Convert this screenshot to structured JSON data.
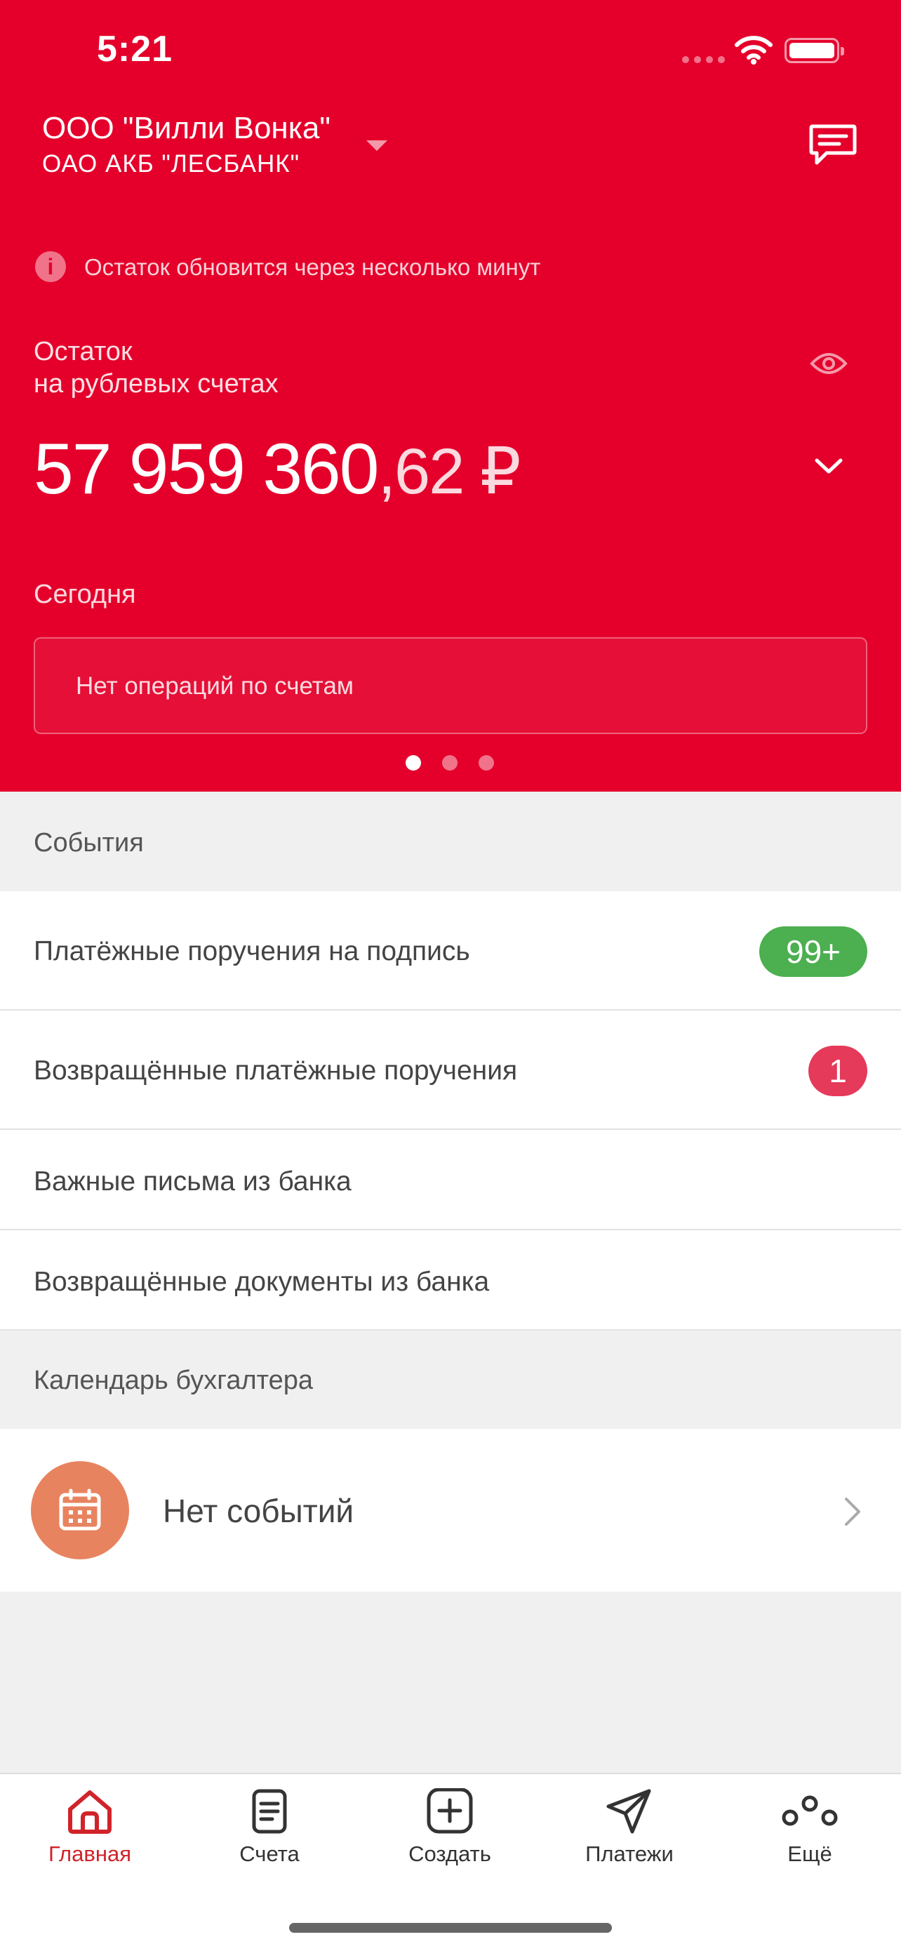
{
  "status_bar": {
    "time": "5:21"
  },
  "header": {
    "company": "ООО \"Вилли Вонка\"",
    "bank": "ОАО АКБ \"ЛЕСБАНК\""
  },
  "notice": "Остаток обновится через несколько минут",
  "balance": {
    "label_line1": "Остаток",
    "label_line2": "на рублевых счетах",
    "amount_int": "57 959 360",
    "amount_frac": ",62 ₽"
  },
  "today": {
    "label": "Сегодня",
    "empty_text": "Нет операций по счетам"
  },
  "carousel": {
    "pages": 3,
    "active": 1
  },
  "events": {
    "title": "События",
    "items": [
      {
        "label": "Платёжные поручения на подпись",
        "badge": "99+",
        "badge_color": "#4caf50"
      },
      {
        "label": "Возвращённые платёжные поручения",
        "badge": "1",
        "badge_color": "#e53a5a"
      },
      {
        "label": "Важные письма из банка"
      },
      {
        "label": "Возвращённые документы из банка"
      }
    ]
  },
  "calendar": {
    "title": "Календарь бухгалтера",
    "empty_text": "Нет событий",
    "icon": "calendar-icon",
    "icon_bg": "#e8835f"
  },
  "tabbar": {
    "accent": "#d1232a",
    "tabs": [
      {
        "label": "Главная",
        "icon": "home-icon",
        "active": true
      },
      {
        "label": "Счета",
        "icon": "document-icon"
      },
      {
        "label": "Создать",
        "icon": "plus-square-icon"
      },
      {
        "label": "Платежи",
        "icon": "paper-plane-icon"
      },
      {
        "label": "Ещё",
        "icon": "more-icon"
      }
    ]
  },
  "colors": {
    "brand": "#e4002b",
    "background": "#f0f0f0"
  }
}
